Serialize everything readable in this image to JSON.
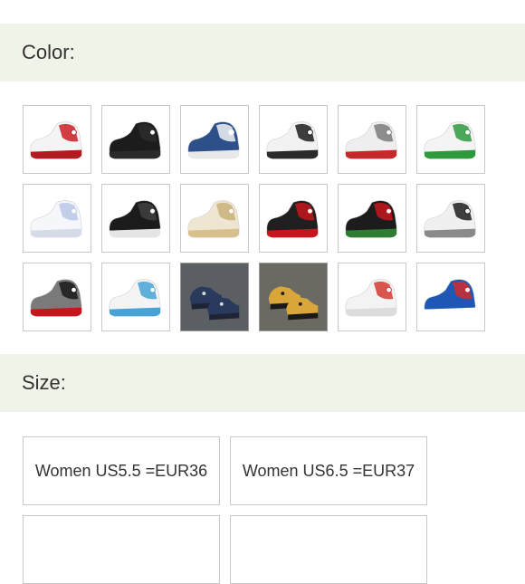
{
  "color_section": {
    "label": "Color:",
    "swatches": [
      {
        "icon": "sneaker-white-red-icon",
        "colors": {
          "upper": "#f4f4f4",
          "accent": "#c91f25",
          "sole": "#b01c22",
          "bg": "#ffffff"
        }
      },
      {
        "icon": "sneaker-black-icon",
        "colors": {
          "upper": "#1c1c1c",
          "accent": "#2b2b2b",
          "sole": "#2a2a2a",
          "bg": "#ffffff"
        }
      },
      {
        "icon": "sneaker-navy-white-icon",
        "colors": {
          "upper": "#2d4f8a",
          "accent": "#f2f2f2",
          "sole": "#e8e8e8",
          "bg": "#ffffff"
        }
      },
      {
        "icon": "sneaker-white-black-icon",
        "colors": {
          "upper": "#f2f2f2",
          "accent": "#1d1d1d",
          "sole": "#2a2a2a",
          "bg": "#ffffff"
        }
      },
      {
        "icon": "sneaker-white-grey-red-icon",
        "colors": {
          "upper": "#eeeeee",
          "accent": "#7b7b7b",
          "sole": "#c42a2a",
          "bg": "#ffffff"
        }
      },
      {
        "icon": "sneaker-white-green-icon",
        "colors": {
          "upper": "#f4f4f4",
          "accent": "#2e9a3c",
          "sole": "#2e9a3c",
          "bg": "#ffffff"
        }
      },
      {
        "icon": "sneaker-white-blue-icon",
        "colors": {
          "upper": "#f5f7fb",
          "accent": "#b8c7e6",
          "sole": "#d6dbe8",
          "bg": "#ffffff"
        }
      },
      {
        "icon": "sneaker-black-white-icon",
        "colors": {
          "upper": "#1b1b1b",
          "accent": "#404040",
          "sole": "#e5e5e5",
          "bg": "#ffffff"
        }
      },
      {
        "icon": "sneaker-cream-gold-icon",
        "colors": {
          "upper": "#eee6d0",
          "accent": "#c9b27a",
          "sole": "#d7c08b",
          "bg": "#ffffff"
        }
      },
      {
        "icon": "sneaker-black-red-icon",
        "colors": {
          "upper": "#1f1f1f",
          "accent": "#c4161c",
          "sole": "#c4161c",
          "bg": "#ffffff"
        }
      },
      {
        "icon": "sneaker-black-red-green-icon",
        "colors": {
          "upper": "#1c1c1c",
          "accent": "#c3161c",
          "sole": "#2e7d32",
          "bg": "#ffffff"
        }
      },
      {
        "icon": "sneaker-white-black-grey-icon",
        "colors": {
          "upper": "#f0f0f0",
          "accent": "#1f1f1f",
          "sole": "#8a8a8a",
          "bg": "#ffffff"
        }
      },
      {
        "icon": "sneaker-grey-black-red-icon",
        "colors": {
          "upper": "#7a7a7a",
          "accent": "#1a1a1a",
          "sole": "#c4161c",
          "bg": "#ffffff"
        }
      },
      {
        "icon": "sneaker-white-lightblue-icon",
        "colors": {
          "upper": "#f4f4f4",
          "accent": "#47a3d6",
          "sole": "#47a3d6",
          "bg": "#ffffff"
        }
      },
      {
        "icon": "sneaker-navy-pair-photo-icon",
        "colors": {
          "upper": "#2a3a5c",
          "accent": "#d9d9d9",
          "sole": "#1d2435",
          "bg": "#5b5f63"
        }
      },
      {
        "icon": "sneaker-yellow-pair-photo-icon",
        "colors": {
          "upper": "#d9a63a",
          "accent": "#222222",
          "sole": "#1a1a1a",
          "bg": "#6a6a62"
        }
      },
      {
        "icon": "sneaker-white-grey-red-2-icon",
        "colors": {
          "upper": "#f3f3f3",
          "accent": "#d23a2f",
          "sole": "#dcdcdc",
          "bg": "#ffffff"
        }
      },
      {
        "icon": "sneaker-blue-red-star-icon",
        "colors": {
          "upper": "#1f57b7",
          "accent": "#d22b2b",
          "sole": "#ffffff",
          "bg": "#ffffff"
        }
      }
    ]
  },
  "size_section": {
    "label": "Size:",
    "options": [
      {
        "label": "Women US5.5 =EUR36"
      },
      {
        "label": "Women US6.5 =EUR37"
      }
    ]
  }
}
